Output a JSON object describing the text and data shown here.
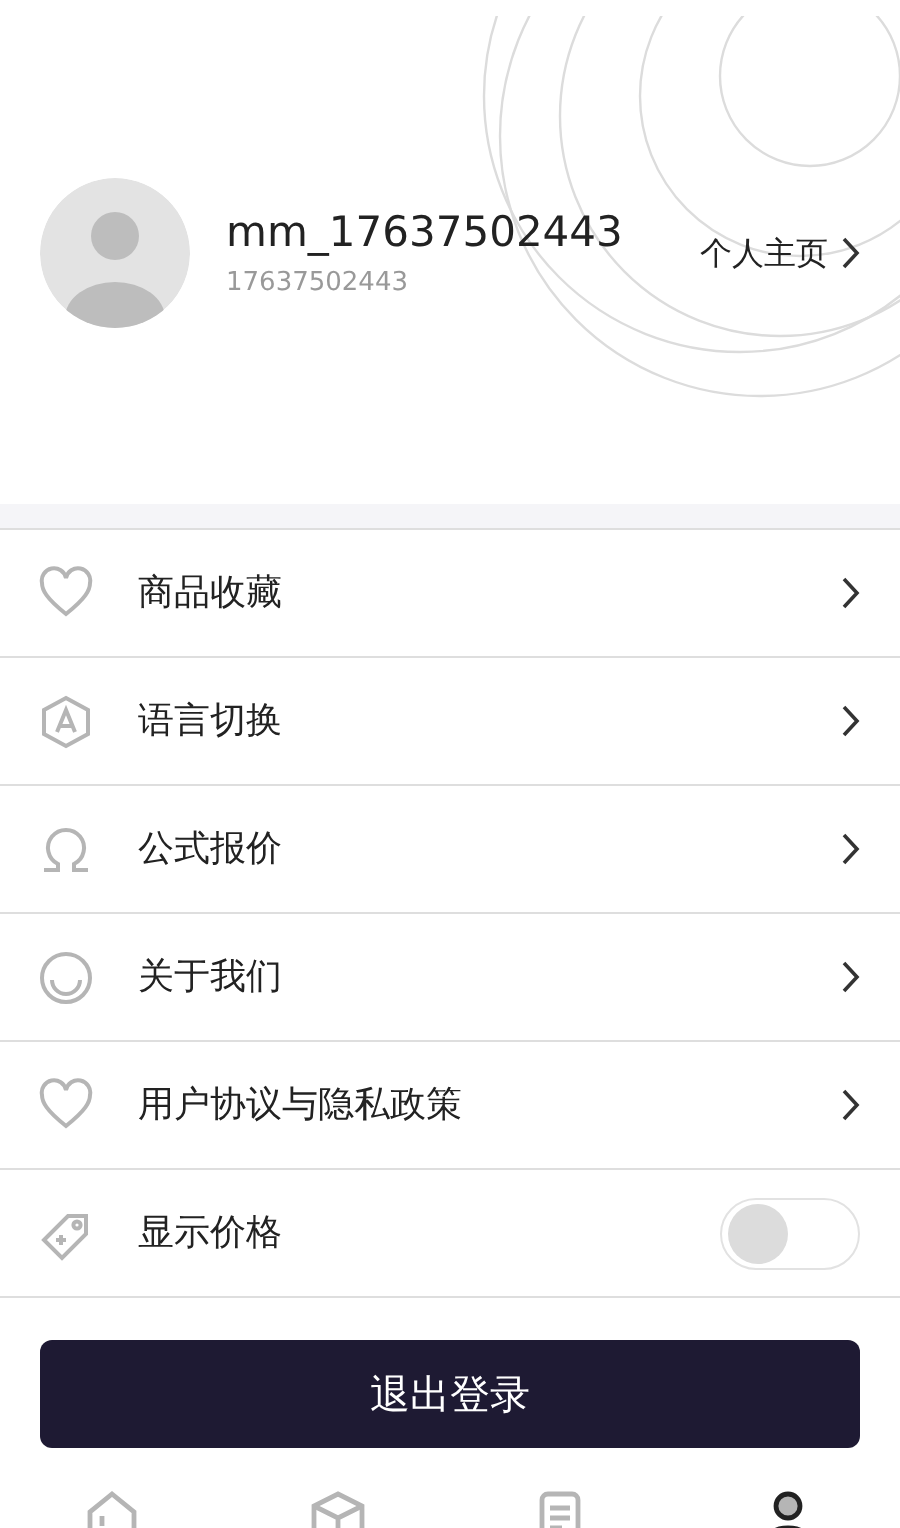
{
  "profile": {
    "username": "mm_17637502443",
    "phone": "17637502443",
    "home_link": "个人主页"
  },
  "menu": [
    {
      "kind": "link",
      "label": "商品收藏"
    },
    {
      "kind": "link",
      "label": "语言切换"
    },
    {
      "kind": "link",
      "label": "公式报价"
    },
    {
      "kind": "link",
      "label": "关于我们"
    },
    {
      "kind": "link",
      "label": "用户协议与隐私政策"
    },
    {
      "kind": "toggle",
      "label": "显示价格",
      "on": false
    }
  ],
  "logout_button": "退出登录",
  "tabs": [
    {
      "selected": false
    },
    {
      "selected": false
    },
    {
      "selected": false
    },
    {
      "selected": true
    }
  ]
}
